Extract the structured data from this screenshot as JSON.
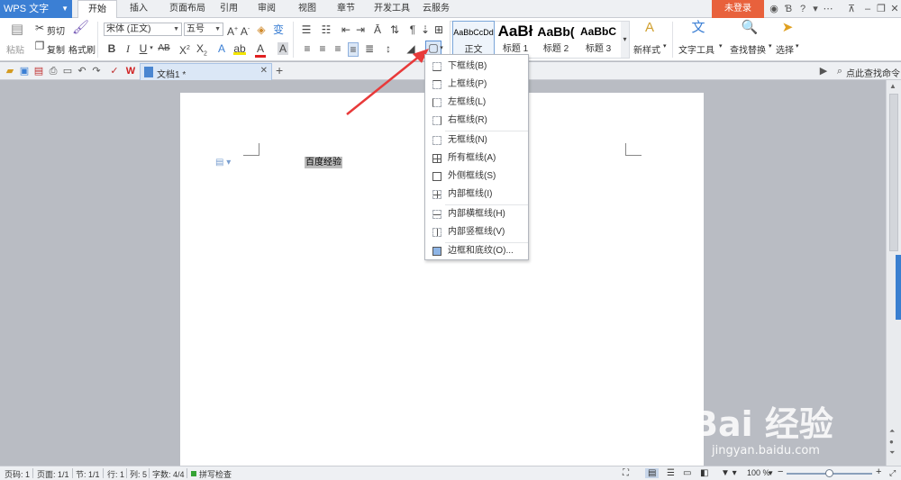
{
  "app": {
    "title": "WPS 文字"
  },
  "menu": {
    "tabs": [
      "开始",
      "插入",
      "页面布局",
      "引用",
      "审阅",
      "视图",
      "章节",
      "开发工具",
      "云服务"
    ],
    "login": "未登录"
  },
  "ribbon": {
    "clipboard": {
      "paste": "粘贴",
      "cut": "剪切",
      "copy": "复制",
      "format_painter": "格式刷"
    },
    "font": {
      "name": "宋体 (正文)",
      "size": "五号"
    },
    "styles": [
      {
        "sample": "AaBbCcDd",
        "name": "正文"
      },
      {
        "sample": "AaBł",
        "name": "标题 1"
      },
      {
        "sample": "AaBb(",
        "name": "标题 2"
      },
      {
        "sample": "AaBbC",
        "name": "标题 3"
      }
    ],
    "new_style": "新样式",
    "text_tools": "文字工具",
    "find_replace": "查找替换",
    "select": "选择"
  },
  "tabbar": {
    "doc_tab": "文档1 *",
    "search_cmd": "点此查找命令"
  },
  "document": {
    "selected_text": "百度经验"
  },
  "border_menu": {
    "items": [
      "下框线(B)",
      "上框线(P)",
      "左框线(L)",
      "右框线(R)",
      "无框线(N)",
      "所有框线(A)",
      "外侧框线(S)",
      "内部框线(I)",
      "内部横框线(H)",
      "内部竖框线(V)",
      "边框和底纹(O)..."
    ]
  },
  "status": {
    "page_num": "页码: 1",
    "pages": "页面: 1/1",
    "section": "节: 1/1",
    "row": "行: 1",
    "col": "列: 5",
    "words": "字数: 4/4",
    "spell": "拼写检查",
    "zoom": "100 %"
  },
  "watermark": {
    "text": "Bai 经验",
    "url": "jingyan.baidu.com"
  },
  "colors": {
    "accent": "#3b7fd4",
    "login": "#e8613c",
    "arrow": "#e83a3a"
  }
}
